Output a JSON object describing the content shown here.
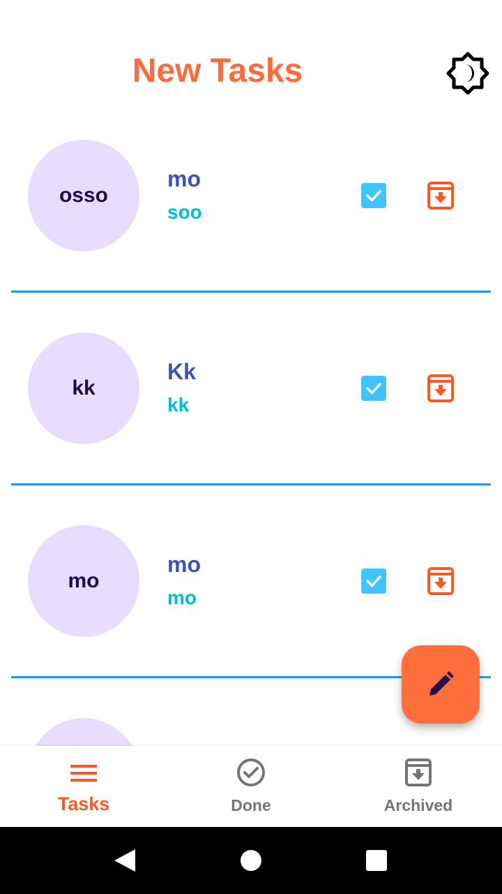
{
  "app_bar": {
    "title": "New Tasks",
    "theme_toggle_icon": "brightness-moon-icon"
  },
  "tasks": [
    {
      "avatar": "osso",
      "title": "mo",
      "subtitle": "soo"
    },
    {
      "avatar": "kk",
      "title": "Kk",
      "subtitle": "kk"
    },
    {
      "avatar": "mo",
      "title": "mo",
      "subtitle": "mo"
    },
    {
      "avatar": "",
      "title": "",
      "subtitle": ""
    }
  ],
  "fab": {
    "icon": "edit-pencil-icon"
  },
  "bottom_nav": {
    "items": [
      {
        "label": "Tasks",
        "icon": "menu-icon",
        "active": true
      },
      {
        "label": "Done",
        "icon": "check-circle-icon",
        "active": false
      },
      {
        "label": "Archived",
        "icon": "archive-icon",
        "active": false
      }
    ]
  },
  "colors": {
    "accent": "#ff6b3d",
    "divider": "#2196f3",
    "checkbox": "#40c4ff",
    "avatar_bg": "#e9ddff",
    "task_title": "#3f51b5",
    "task_subtitle": "#00bcd4"
  }
}
